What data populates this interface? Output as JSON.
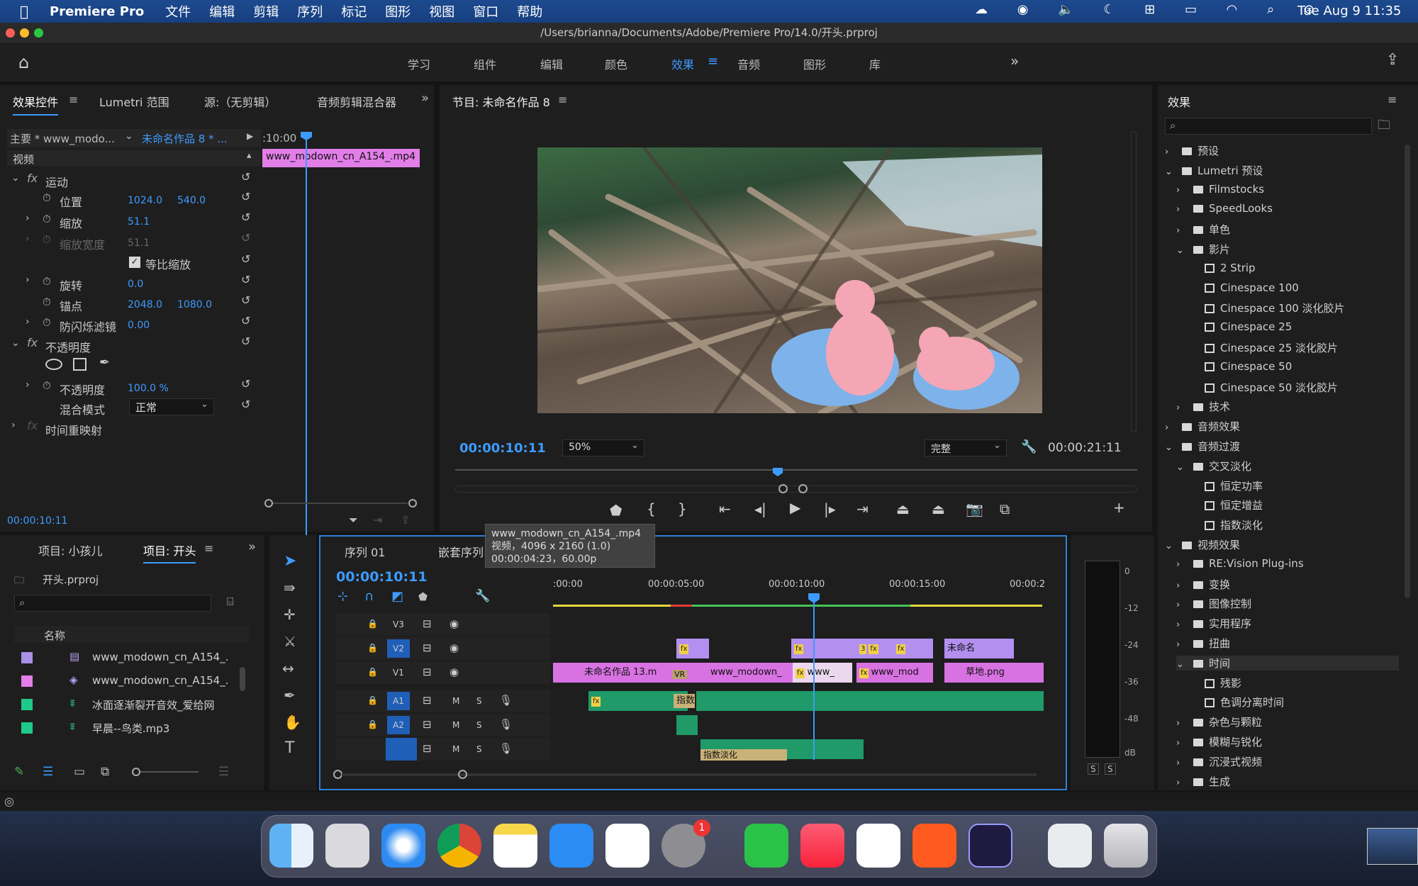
{
  "menubar": {
    "app": "Premiere Pro",
    "items": [
      "文件",
      "编辑",
      "剪辑",
      "序列",
      "标记",
      "图形",
      "视图",
      "窗口",
      "帮助"
    ],
    "clock": "Tue Aug 9  11:35"
  },
  "titlebar": {
    "path": "/Users/brianna/Documents/Adobe/Premiere Pro/14.0/开头.prproj"
  },
  "workspaces": [
    "学习",
    "组件",
    "编辑",
    "颜色",
    "效果",
    "音频",
    "图形",
    "库"
  ],
  "active_workspace": "效果",
  "effect_controls": {
    "tabs": [
      "效果控件",
      "Lumetri 范围",
      "源:（无剪辑）",
      "音频剪辑混合器"
    ],
    "master": "主要 * www_modo...",
    "sequence": "未命名作品 8 * ...",
    "timecode_head": ":10:00",
    "clip_label": "www_modown_cn_A154_.mp4",
    "video_header": "视频",
    "motion": "运动",
    "position_label": "位置",
    "position_x": "1024.0",
    "position_y": "540.0",
    "scale_label": "缩放",
    "scale": "51.1",
    "scale_width_label": "缩放宽度",
    "scale_width": "51.1",
    "uniform_scale": "等比缩放",
    "rotation_label": "旋转",
    "rotation": "0.0",
    "anchor_label": "锚点",
    "anchor_x": "2048.0",
    "anchor_y": "1080.0",
    "antiflicker_label": "防闪烁滤镜",
    "antiflicker": "0.00",
    "opacity_section": "不透明度",
    "opacity_label": "不透明度",
    "opacity": "100.0 %",
    "blend_label": "混合模式",
    "blend": "正常",
    "time_remap": "时间重映射",
    "timecode": "00:00:10:11"
  },
  "program": {
    "title": "节目: 未命名作品 8",
    "timecode": "00:00:10:11",
    "zoom": "50%",
    "quality": "完整",
    "duration": "00:00:21:11"
  },
  "effects_panel": {
    "title": "效果",
    "tree": [
      {
        "label": "预设",
        "level": 0,
        "type": "folder"
      },
      {
        "label": "Lumetri 预设",
        "level": 0,
        "type": "folder"
      },
      {
        "label": "Filmstocks",
        "level": 1,
        "type": "folder"
      },
      {
        "label": "SpeedLooks",
        "level": 1,
        "type": "folder"
      },
      {
        "label": "单色",
        "level": 1,
        "type": "folder"
      },
      {
        "label": "影片",
        "level": 1,
        "type": "folder"
      },
      {
        "label": "2 Strip",
        "level": 2,
        "type": "preset"
      },
      {
        "label": "Cinespace 100",
        "level": 2,
        "type": "preset"
      },
      {
        "label": "Cinespace 100 淡化胶片",
        "level": 2,
        "type": "preset"
      },
      {
        "label": "Cinespace 25",
        "level": 2,
        "type": "preset"
      },
      {
        "label": "Cinespace 25 淡化胶片",
        "level": 2,
        "type": "preset"
      },
      {
        "label": "Cinespace 50",
        "level": 2,
        "type": "preset"
      },
      {
        "label": "Cinespace 50 淡化胶片",
        "level": 2,
        "type": "preset"
      },
      {
        "label": "技术",
        "level": 1,
        "type": "folder"
      },
      {
        "label": "音频效果",
        "level": 0,
        "type": "folder"
      },
      {
        "label": "音频过渡",
        "level": 0,
        "type": "folder"
      },
      {
        "label": "交叉淡化",
        "level": 1,
        "type": "folder"
      },
      {
        "label": "恒定功率",
        "level": 2,
        "type": "fx"
      },
      {
        "label": "恒定增益",
        "level": 2,
        "type": "fx"
      },
      {
        "label": "指数淡化",
        "level": 2,
        "type": "fx"
      },
      {
        "label": "视频效果",
        "level": 0,
        "type": "folder"
      },
      {
        "label": "RE:Vision Plug-ins",
        "level": 1,
        "type": "folder"
      },
      {
        "label": "变换",
        "level": 1,
        "type": "folder"
      },
      {
        "label": "图像控制",
        "level": 1,
        "type": "folder"
      },
      {
        "label": "实用程序",
        "level": 1,
        "type": "folder"
      },
      {
        "label": "扭曲",
        "level": 1,
        "type": "folder"
      },
      {
        "label": "时间",
        "level": 1,
        "type": "folder"
      },
      {
        "label": "残影",
        "level": 2,
        "type": "preset"
      },
      {
        "label": "色调分离时间",
        "level": 2,
        "type": "preset"
      },
      {
        "label": "杂色与颗粒",
        "level": 1,
        "type": "folder"
      },
      {
        "label": "模糊与锐化",
        "level": 1,
        "type": "folder"
      },
      {
        "label": "沉浸式视频",
        "level": 1,
        "type": "folder"
      },
      {
        "label": "生成",
        "level": 1,
        "type": "folder"
      }
    ]
  },
  "project": {
    "tabs": [
      "项目: 小孩儿",
      "项目: 开头"
    ],
    "file": "开头.prproj",
    "name_header": "名称",
    "items": [
      {
        "name": "www_modown_cn_A154_.",
        "color": "#a98fe6"
      },
      {
        "name": "www_modown_cn_A154_.",
        "color": "#e27ee8"
      },
      {
        "name": "冰面逐渐裂开音效_爱给网",
        "color": "#1fc98a"
      },
      {
        "name": "早晨--鸟类.mp3",
        "color": "#1fc98a"
      }
    ]
  },
  "timeline": {
    "tabs": [
      "序列 01",
      "嵌套序列"
    ],
    "timecode": "00:00:10:11",
    "ruler": [
      ":00:00",
      "00:00:05:00",
      "00:00:10:00",
      "00:00:15:00",
      "00:00:2"
    ],
    "tracks_v": [
      "V3",
      "V2",
      "V1"
    ],
    "tracks_a": [
      "A1",
      "A2"
    ],
    "tooltip": {
      "line1": "www_modown_cn_A154_.mp4",
      "line2": "视频，4096 x 2160 (1.0)",
      "line3": "00:00:04:23，60.00p"
    },
    "clips": {
      "v1a": "未命名作品 13.m",
      "v1b": "www_modown_",
      "v1c": "www_",
      "v1d": "www_mod",
      "v1e": "草地.png",
      "v2e": "未命名",
      "vr": "VR",
      "a1": "指数",
      "a3": "指数淡化",
      "fx": "fx",
      "three": "3"
    }
  },
  "meter": {
    "ticks": [
      "0",
      "-12",
      "-24",
      "-36",
      "-48",
      "dB"
    ]
  },
  "badge": "1"
}
